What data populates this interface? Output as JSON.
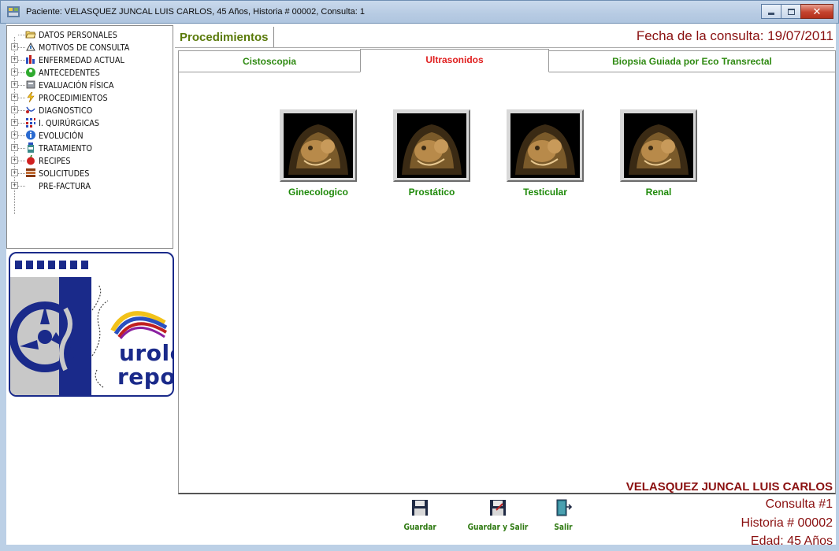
{
  "window": {
    "title": "Paciente: VELASQUEZ JUNCAL LUIS CARLOS, 45 Años, Historia # 00002, Consulta: 1"
  },
  "tree": {
    "items": [
      {
        "label": "DATOS PERSONALES",
        "icon": "folder-open-icon"
      },
      {
        "label": "MOTIVOS DE CONSULTA",
        "icon": "warning-hand-icon"
      },
      {
        "label": "ENFERMEDAD ACTUAL",
        "icon": "bar-chart-icon"
      },
      {
        "label": "ANTECEDENTES",
        "icon": "green-person-icon"
      },
      {
        "label": "EVALUACIÓN FÍSICA",
        "icon": "scale-icon"
      },
      {
        "label": "PROCEDIMIENTOS",
        "icon": "lightning-icon"
      },
      {
        "label": "DIAGNOSTICO",
        "icon": "stethoscope-icon"
      },
      {
        "label": "I. QUIRÚRGICAS",
        "icon": "grid-dots-icon"
      },
      {
        "label": "EVOLUCIÓN",
        "icon": "info-icon"
      },
      {
        "label": "TRATAMIENTO",
        "icon": "pill-bottle-icon"
      },
      {
        "label": "RECIPES",
        "icon": "apple-icon"
      },
      {
        "label": "SOLICITUDES",
        "icon": "document-stack-icon"
      },
      {
        "label": "PRE-FACTURA",
        "icon": ""
      }
    ]
  },
  "logo": {
    "word1": "urolo",
    "word2": "report"
  },
  "header": {
    "section_tab": "Procedimientos",
    "fecha": "Fecha de la consulta:  19/07/2011"
  },
  "tabs": [
    {
      "label": "Cistoscopia",
      "active": false
    },
    {
      "label": "Ultrasonidos",
      "active": true
    },
    {
      "label": "Biopsia Guiada por Eco Transrectal",
      "active": false
    }
  ],
  "ultrasonidos": [
    {
      "label": "Ginecologico"
    },
    {
      "label": "Prostático"
    },
    {
      "label": "Testicular"
    },
    {
      "label": "Renal"
    }
  ],
  "footer": {
    "patient_name": "VELASQUEZ JUNCAL LUIS CARLOS",
    "consulta": "Consulta #1",
    "historia": "Historia # 00002",
    "edad": "Edad: 45 Años",
    "buttons": {
      "guardar": "Guardar",
      "guardar_salir": "Guardar y Salir",
      "salir": "Salir"
    }
  },
  "colors": {
    "accent_red": "#8a1010",
    "tab_green": "#2f8a12",
    "active_tab_red": "#e02020",
    "logo_blue": "#1a2a8a"
  }
}
